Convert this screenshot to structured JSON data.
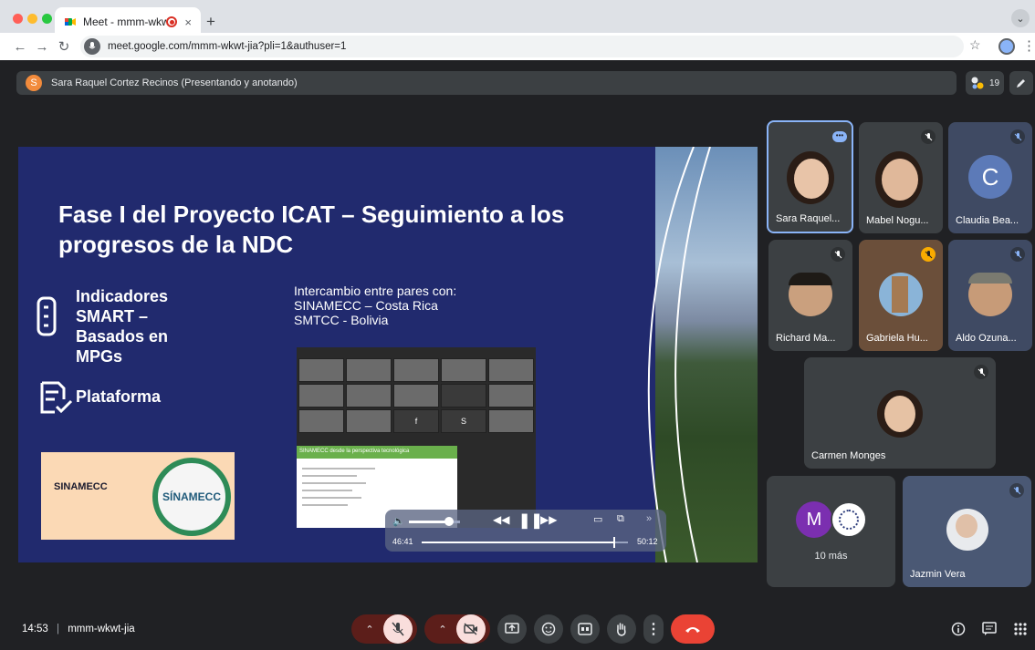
{
  "browser": {
    "tab_title": "Meet - mmm-wkwt-jia",
    "new_tab_icon": "plus-icon",
    "url": "meet.google.com/mmm-wkwt-jia?pli=1&authuser=1",
    "traffic_lights": [
      "#ff5f57",
      "#febc2e",
      "#28c840"
    ]
  },
  "presenting": {
    "initial": "S",
    "label": "Sara Raquel Cortez Recinos (Presentando y anotando)",
    "participant_count": "19"
  },
  "slide": {
    "title": "Fase I del Proyecto ICAT – Seguimiento a los progresos de la NDC",
    "bullet1": "Indicadores SMART – Basados en MPGs",
    "bullet2": "Plataforma",
    "intro": "Intercambio entre pares con:",
    "peer1": "SINAMECC – Costa Rica",
    "peer2": "SMTCC - Bolivia",
    "logo_text": "SINAMECC",
    "seal_text": "SÍNAMECC",
    "thumb_header": "SINAMECC desde la perspectiva tecnológica",
    "thumb_initials": [
      "f",
      "S"
    ]
  },
  "player": {
    "current_time": "46:41",
    "total_time": "50:12",
    "progress": 0.93,
    "volume": 0.78
  },
  "participants": [
    {
      "name": "Sara Raquel...",
      "muted": false,
      "speaking": true,
      "skin": "#e8c4a8",
      "hair": "#2b1d16"
    },
    {
      "name": "Mabel Nogu...",
      "muted": true,
      "skin": "#e0b89a",
      "hair": "#2b1d16"
    },
    {
      "name": "Claudia Bea...",
      "muted": true,
      "initial": "C",
      "avatar_color": "#5c7ab8"
    },
    {
      "name": "Richard Ma...",
      "muted": true,
      "skin": "#caa07e",
      "hair": "#1e1a16"
    },
    {
      "name": "Gabriela Hu...",
      "muted": true,
      "skin": "#d9b48c",
      "hair": "#6b4a2a"
    },
    {
      "name": "Aldo Ozuna...",
      "muted": true,
      "skin": "#c79b78",
      "hair": "#7a7a70"
    },
    {
      "name": "Carmen Monges",
      "muted": false,
      "skin": "#e6c2a4",
      "hair": "#2b1d16"
    },
    {
      "name": "10 más",
      "muted": false,
      "initial": "M",
      "avatar_color": "#7b2fb0"
    },
    {
      "name": "Jazmin Vera",
      "muted": true,
      "skin": "#e0c0a8",
      "hair": "#3a2a20"
    }
  ],
  "bottom": {
    "time": "14:53",
    "meeting_code": "mmm-wkwt-jia"
  },
  "colors": {
    "meet_bg": "#202124",
    "slide_bg": "#212a6e",
    "end_call": "#ea4335",
    "muted_btn": "#f9dedc"
  }
}
